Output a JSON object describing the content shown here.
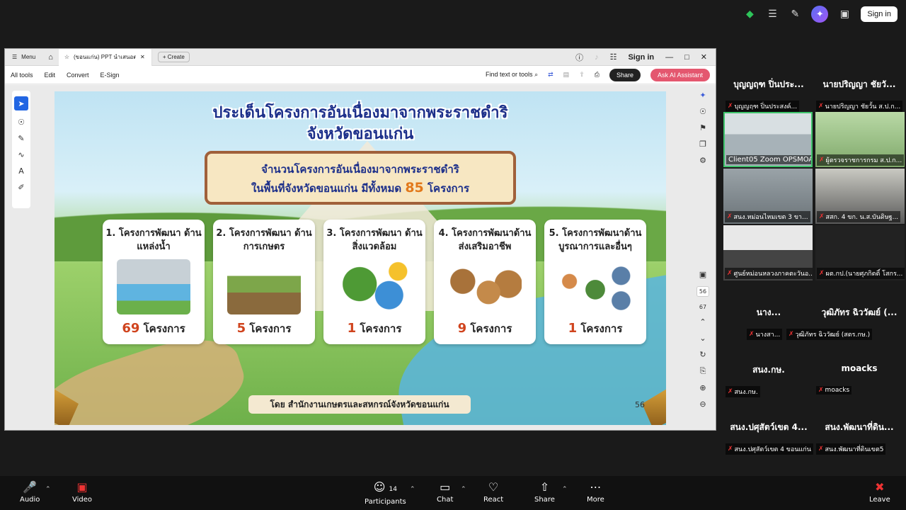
{
  "zoom_top": {
    "sign_in_label": "Sign in"
  },
  "acrobat": {
    "menu_label": "Menu",
    "tab_title": "(ขอนแก่น) PPT นำเสนอตรว...",
    "create_label": "Create",
    "sign_in_label": "Sign in",
    "tools": [
      "All tools",
      "Edit",
      "Convert",
      "E-Sign"
    ],
    "find_label": "Find text or tools",
    "share_label": "Share",
    "ask_ai_label": "Ask AI Assistant",
    "page_current": "56",
    "page_total": "67"
  },
  "slide": {
    "title_line1": "ประเด็นโครงการอันเนื่องมาจากพระราชดำริ",
    "title_line2": "จังหวัดขอนแก่น",
    "banner_line1": "จำนวนโครงการอันเนื่องมาจากพระราชดำริ",
    "banner_line2_prefix": "ในพื้นที่จังหวัดขอนแก่น มีทั้งหมด",
    "banner_number": "85",
    "banner_suffix": "โครงการ",
    "cards": [
      {
        "title": "1. โครงการพัฒนา ด้านแหล่งน้ำ",
        "count": "69",
        "unit": "โครงการ"
      },
      {
        "title": "2. โครงการพัฒนา ด้านการเกษตร",
        "count": "5",
        "unit": "โครงการ"
      },
      {
        "title": "3. โครงการพัฒนา ด้านสิ่งแวดล้อม",
        "count": "1",
        "unit": "โครงการ"
      },
      {
        "title": "4. โครงการพัฒนาด้าน ส่งเสริมอาชีพ",
        "count": "9",
        "unit": "โครงการ"
      },
      {
        "title": "5. โครงการพัฒนาด้าน บูรณาการและอื่นๆ",
        "count": "1",
        "unit": "โครงการ"
      }
    ],
    "footer": "โดย สำนักงานเกษตรและสหกรณ์จังหวัดขอนแก่น",
    "page_number": "56"
  },
  "participants": [
    {
      "name": "บุญญฤฑ ปิ่นประ...",
      "tag": "บุญญฤฑ ปิ่นประสงค์..."
    },
    {
      "name": "นายปริญญา ชัยวั...",
      "tag": "นายปริญญา ชัยวั้น ส.ป.ก..."
    },
    {
      "tag": "Client05 Zoom OPSMOAC"
    },
    {
      "tag": "ผู้ตรวจราชการกรม ส.ป.ก..."
    },
    {
      "tag": "สนง.หม่อนไหมเขต 3 ขา..."
    },
    {
      "tag": "สสก. 4 ขก. น.ส.บันดิษฐ..."
    },
    {
      "tag": "ศูนย์หม่อนหลวงภาคตะวันอ..."
    },
    {
      "tag": "ผต.กป.(นายศุภกิตติ์ โสกร..."
    },
    {
      "name": "นาง...",
      "tag": "นางสา..."
    },
    {
      "name": "วุฒิภัทร ฉิววัฒย์ (...",
      "tag": "วุฒิภัทร ฉิววัฒย์ (สตร.กษ.)"
    },
    {
      "name": "สนง.กษ.",
      "tag": "สนง.กษ."
    },
    {
      "name": "moacks",
      "tag": "moacks"
    },
    {
      "name": "สนง.ปศุสัตว์เขต 4...",
      "tag": "สนง.ปศุสัตว์เขต 4 ขอนแก่น"
    },
    {
      "name": "สนง.พัฒนาที่ดิน...",
      "tag": "สนง.พัฒนาที่ดินเขต5"
    }
  ],
  "bottom_bar": {
    "audio": "Audio",
    "video": "Video",
    "participants": "Participants",
    "participants_count": "14",
    "chat": "Chat",
    "react": "React",
    "share": "Share",
    "more": "More",
    "leave": "Leave"
  }
}
